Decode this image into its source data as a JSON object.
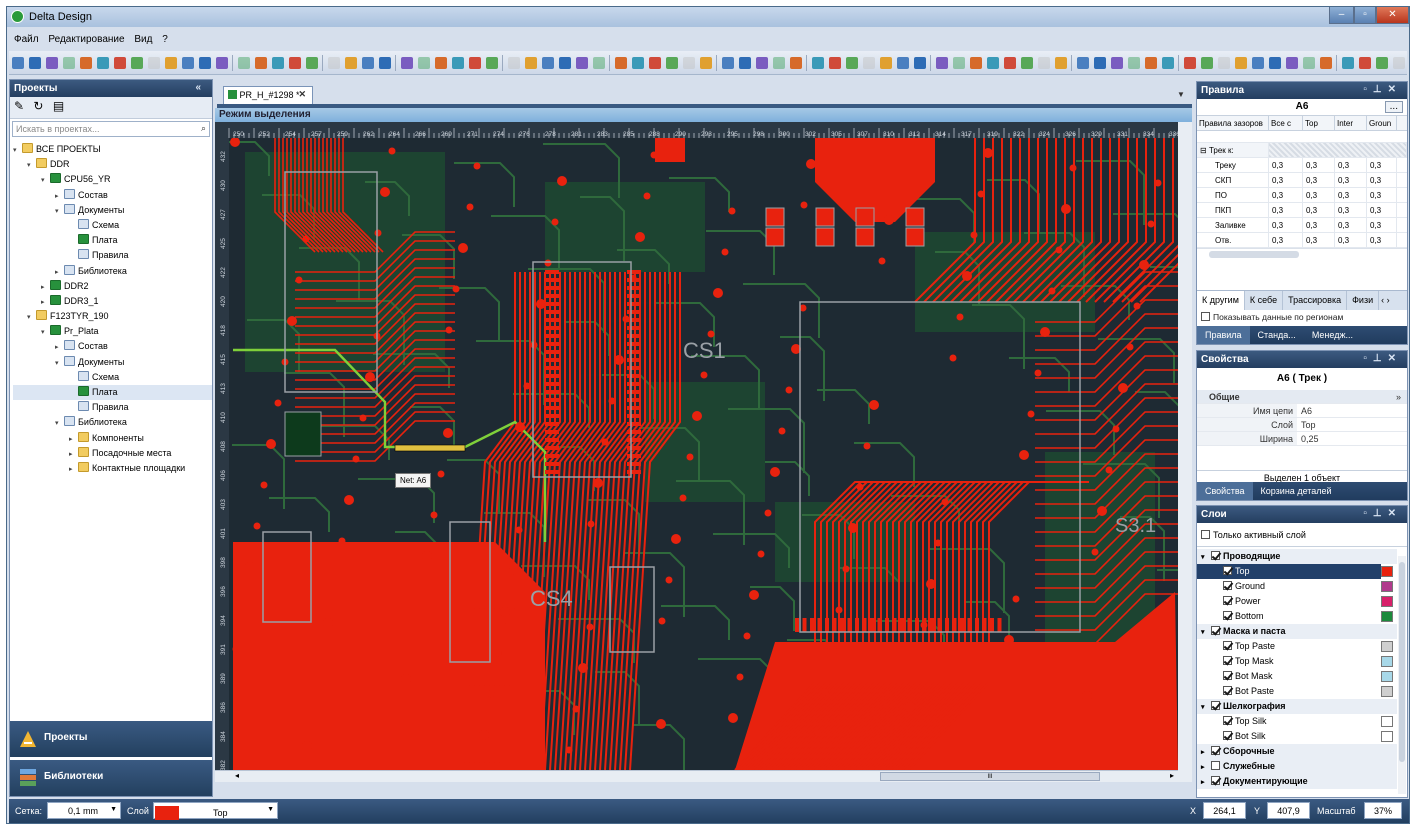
{
  "window": {
    "title": "Delta Design"
  },
  "menu": [
    "Файл",
    "Редактирование",
    "Вид",
    "?"
  ],
  "projects_panel": {
    "title": "Проекты",
    "search_placeholder": "Искать в проектах...",
    "tree": [
      {
        "label": "ВСЕ ПРОЕКТЫ",
        "level": 0,
        "icon": "folder",
        "arrow": "▾"
      },
      {
        "label": "DDR",
        "level": 1,
        "icon": "folder",
        "arrow": "▾"
      },
      {
        "label": "CPU56_YR",
        "level": 2,
        "icon": "board",
        "arrow": "▾"
      },
      {
        "label": "Состав",
        "level": 3,
        "icon": "doc",
        "arrow": "▸"
      },
      {
        "label": "Документы",
        "level": 3,
        "icon": "doc",
        "arrow": "▾"
      },
      {
        "label": "Схема",
        "level": 4,
        "icon": "doc",
        "arrow": ""
      },
      {
        "label": "Плата",
        "level": 4,
        "icon": "board",
        "arrow": ""
      },
      {
        "label": "Правила",
        "level": 4,
        "icon": "doc",
        "arrow": ""
      },
      {
        "label": "Библиотека",
        "level": 3,
        "icon": "doc",
        "arrow": "▸"
      },
      {
        "label": "DDR2",
        "level": 2,
        "icon": "board",
        "arrow": "▸"
      },
      {
        "label": "DDR3_1",
        "level": 2,
        "icon": "board",
        "arrow": "▸"
      },
      {
        "label": "F123TYR_190",
        "level": 1,
        "icon": "folder",
        "arrow": "▾"
      },
      {
        "label": "Pr_Plata",
        "level": 2,
        "icon": "board",
        "arrow": "▾"
      },
      {
        "label": "Состав",
        "level": 3,
        "icon": "doc",
        "arrow": "▸"
      },
      {
        "label": "Документы",
        "level": 3,
        "icon": "doc",
        "arrow": "▾"
      },
      {
        "label": "Схема",
        "level": 4,
        "icon": "doc",
        "arrow": ""
      },
      {
        "label": "Плата",
        "level": 4,
        "icon": "board",
        "arrow": "",
        "selected": true
      },
      {
        "label": "Правила",
        "level": 4,
        "icon": "doc",
        "arrow": ""
      },
      {
        "label": "Библиотека",
        "level": 3,
        "icon": "doc",
        "arrow": "▾"
      },
      {
        "label": "Компоненты",
        "level": 4,
        "icon": "folder",
        "arrow": "▸"
      },
      {
        "label": "Посадочные места",
        "level": 4,
        "icon": "folder",
        "arrow": "▸"
      },
      {
        "label": "Контактные площадки",
        "level": 4,
        "icon": "folder",
        "arrow": "▸"
      }
    ],
    "nav_projects": "Проекты",
    "nav_libraries": "Библиотеки"
  },
  "document": {
    "tab_label": "PR_H_#1298 *",
    "mode_label": "Режим выделения",
    "ruler_x": [
      "250",
      "252",
      "254",
      "257",
      "259",
      "262",
      "264",
      "266",
      "269",
      "271",
      "274",
      "276",
      "278",
      "281",
      "283",
      "285",
      "288",
      "290",
      "293",
      "295",
      "298",
      "300",
      "302",
      "305",
      "307",
      "310",
      "312",
      "314",
      "317",
      "319",
      "322",
      "324",
      "326",
      "329",
      "331",
      "334",
      "336"
    ],
    "ruler_y": [
      "432",
      "430",
      "427",
      "425",
      "422",
      "420",
      "418",
      "415",
      "413",
      "410",
      "408",
      "406",
      "403",
      "401",
      "398",
      "396",
      "394",
      "391",
      "389",
      "386",
      "384",
      "382"
    ],
    "labels": {
      "cs1": "CS1",
      "cs4": "CS4",
      "cs3": "S3.1"
    },
    "tooltip": "Net: A6",
    "scroll_mid": "III"
  },
  "rules_panel": {
    "title": "Правила",
    "subtitle": "A6",
    "more_button": "...",
    "columns": [
      "Правила зазоров",
      "Все с",
      "Top",
      "Inter",
      "Groun"
    ],
    "group_label": "Трек к:",
    "rows": [
      {
        "name": "Треку",
        "vals": [
          "0,3",
          "0,3",
          "0,3",
          "0,3"
        ]
      },
      {
        "name": "СКП",
        "vals": [
          "0,3",
          "0,3",
          "0,3",
          "0,3"
        ]
      },
      {
        "name": "ПО",
        "vals": [
          "0,3",
          "0,3",
          "0,3",
          "0,3"
        ]
      },
      {
        "name": "ПКП",
        "vals": [
          "0,3",
          "0,3",
          "0,3",
          "0,3"
        ]
      },
      {
        "name": "Заливке",
        "vals": [
          "0,3",
          "0,3",
          "0,3",
          "0,3"
        ]
      },
      {
        "name": "Отв.",
        "vals": [
          "0,3",
          "0,3",
          "0,3",
          "0,3"
        ]
      }
    ],
    "subtabs": [
      "К другим",
      "К себе",
      "Трассировка",
      "Физи"
    ],
    "region_check": "Показывать данные по регионам",
    "bottom_tabs": [
      "Правила",
      "Станда...",
      "Менедж..."
    ]
  },
  "props_panel": {
    "title": "Свойства",
    "subtitle": "A6 ( Трек )",
    "section": "Общие",
    "rows": [
      {
        "k": "Имя цепи",
        "v": "A6"
      },
      {
        "k": "Слой",
        "v": "Top"
      },
      {
        "k": "Ширина",
        "v": "0,25"
      }
    ],
    "selected_info": "Выделен 1 объект",
    "bottom_tabs": [
      "Свойства",
      "Корзина деталей"
    ]
  },
  "layers_panel": {
    "title": "Слои",
    "only_active": "Только активный слой",
    "items": [
      {
        "label": "Проводящие",
        "group": true,
        "checked": true,
        "arrow": "▾"
      },
      {
        "label": "Top",
        "checked": true,
        "color": "#e8220e",
        "active": true
      },
      {
        "label": "Ground",
        "checked": true,
        "color": "#b03a8c"
      },
      {
        "label": "Power",
        "checked": true,
        "color": "#d8206a"
      },
      {
        "label": "Bottom",
        "checked": true,
        "color": "#1c8a3c"
      },
      {
        "label": "Маска и паста",
        "group": true,
        "checked": true,
        "arrow": "▾"
      },
      {
        "label": "Top Paste",
        "checked": true,
        "color": "#cfcfcf"
      },
      {
        "label": "Top Mask",
        "checked": true,
        "color": "#a8d8e8"
      },
      {
        "label": "Bot Mask",
        "checked": true,
        "color": "#a8d8e8"
      },
      {
        "label": "Bot Paste",
        "checked": true,
        "color": "#cfcfcf"
      },
      {
        "label": "Шелкография",
        "group": true,
        "checked": true,
        "arrow": "▾"
      },
      {
        "label": "Top Silk",
        "checked": true,
        "color": "#ffffff"
      },
      {
        "label": "Bot Silk",
        "checked": true,
        "color": "#ffffff"
      },
      {
        "label": "Сборочные",
        "group": true,
        "checked": true,
        "arrow": "▸"
      },
      {
        "label": "Служебные",
        "group": true,
        "checked": false,
        "arrow": "▸"
      },
      {
        "label": "Документирующие",
        "group": true,
        "checked": true,
        "arrow": "▸"
      }
    ]
  },
  "statusbar": {
    "grid_label": "Сетка:",
    "grid_value": "0,1 mm",
    "layer_label": "Слой",
    "layer_value": "Top",
    "x_label": "X",
    "x_value": "264,1",
    "y_label": "Y",
    "y_value": "407,9",
    "scale_label": "Масштаб",
    "scale_value": "37%"
  },
  "colors": {
    "copper": "#e8220e",
    "bottom": "#1d5a30",
    "board": "#1e2a33",
    "silk": "#9aa0a6",
    "accent": "#3a5a82"
  }
}
